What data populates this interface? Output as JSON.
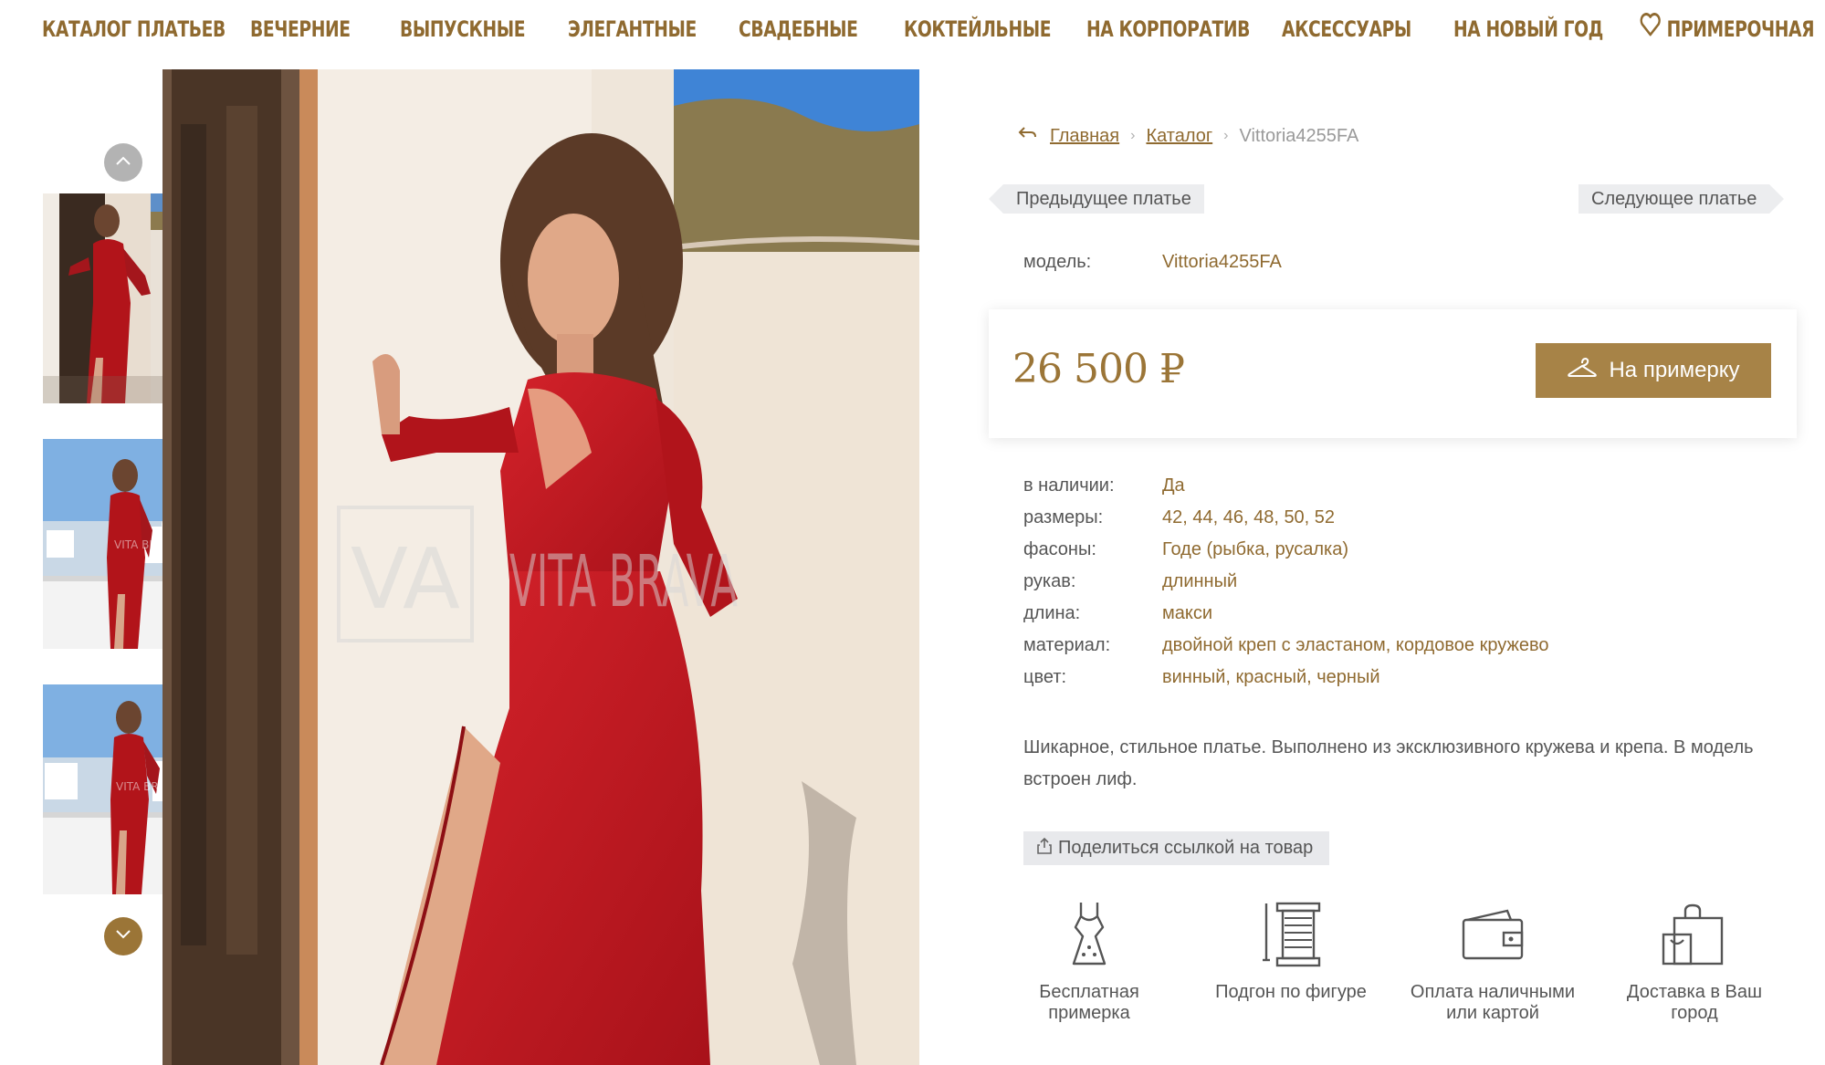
{
  "nav": {
    "items": [
      {
        "label": "КАТАЛОГ ПЛАТЬЕВ"
      },
      {
        "label": "ВЕЧЕРНИЕ"
      },
      {
        "label": "ВЫПУСКНЫЕ"
      },
      {
        "label": "ЭЛЕГАНТНЫЕ"
      },
      {
        "label": "СВАДЕБНЫЕ"
      },
      {
        "label": "КОКТЕЙЛЬНЫЕ"
      },
      {
        "label": "НА КОРПОРАТИВ"
      },
      {
        "label": "АКСЕССУАРЫ"
      },
      {
        "label": "НА НОВЫЙ ГОД"
      }
    ],
    "wishlist_label": "ПРИМЕРОЧНАЯ"
  },
  "gallery": {
    "watermark": {
      "logo": "VA",
      "text": "VITA BRAVA"
    },
    "thumb_watermark": "VITA BRAVA"
  },
  "breadcrumb": {
    "items": [
      {
        "label": "Главная"
      },
      {
        "label": "Каталог"
      }
    ],
    "current": "Vittoria4255FA"
  },
  "pager": {
    "prev_label": "Предыдущее платье",
    "next_label": "Следующее платье"
  },
  "product": {
    "model_key": "модель:",
    "model_value": "Vittoria4255FA",
    "price": "26 500 ₽",
    "tryon_label": "На примерку",
    "specs": [
      {
        "key": "в наличии:",
        "value": "Да"
      },
      {
        "key": "размеры:",
        "value": "42, 44, 46, 48, 50, 52"
      },
      {
        "key": "фасоны:",
        "value": "Годе (рыбка, русалка)"
      },
      {
        "key": "рукав:",
        "value": "длинный"
      },
      {
        "key": "длина:",
        "value": "макси"
      },
      {
        "key": "материал:",
        "value": "двойной креп с эластаном, кордовое кружево"
      },
      {
        "key": "цвет:",
        "value": "винный, красный, черный"
      }
    ],
    "description": "Шикарное, стильное платье. Выполнено из эксклюзивного кружева и крепа. В модель встроен лиф."
  },
  "share_label": "Поделиться ссылкой на товар",
  "features": [
    {
      "icon": "dress-icon",
      "label": "Бесплатная примерка"
    },
    {
      "icon": "thread-spool-icon",
      "label": "Подгон по фигуре"
    },
    {
      "icon": "wallet-icon",
      "label": "Оплата наличными или картой"
    },
    {
      "icon": "shopping-bag-icon",
      "label": "Доставка в Ваш город"
    }
  ],
  "colors": {
    "accent": "#8f6a30",
    "button": "#a78347",
    "dress": "#c0161b"
  }
}
